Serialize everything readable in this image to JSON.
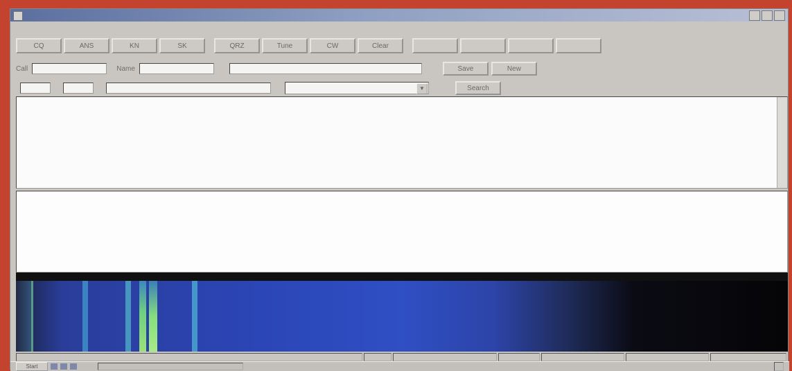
{
  "window": {
    "title": ""
  },
  "menu": [
    "",
    "",
    "",
    "",
    "",
    ""
  ],
  "toolbar": {
    "buttons": [
      "CQ",
      "ANS",
      "KN",
      "SK",
      "QRZ",
      "Tune",
      "CW",
      "Clear",
      "",
      "",
      "",
      ""
    ]
  },
  "qso": {
    "call_label": "Call",
    "call_value": "",
    "name_label": "Name",
    "name_value": "",
    "info_label": "",
    "info_value": "",
    "save_label": "Save",
    "new_label": "New"
  },
  "signal": {
    "rst_label": "",
    "rst_value": "",
    "freq_label": "",
    "freq_value": "",
    "note_label": "",
    "note_value": "",
    "mode_label": "",
    "mode_value": "",
    "search_label": "Search"
  },
  "receive": {
    "lines": [
      "",
      "",
      "",
      "",
      ""
    ]
  },
  "transmit": {
    "text": ""
  },
  "waterfall": {
    "scale_labels": [
      "",
      "",
      "",
      ""
    ],
    "colors": {
      "background": "#2b45b5",
      "dark": "#08080c",
      "trace": "#8fe08a"
    }
  },
  "status": {
    "left": "",
    "mid1": "",
    "mid2": "",
    "mid3": "",
    "right1": "",
    "right2": "",
    "right3": ""
  },
  "taskbar": {
    "start": "Start",
    "task": "",
    "clock": ""
  },
  "colors": {
    "desktop": "#c4432e",
    "window": "#c9c6c2"
  }
}
